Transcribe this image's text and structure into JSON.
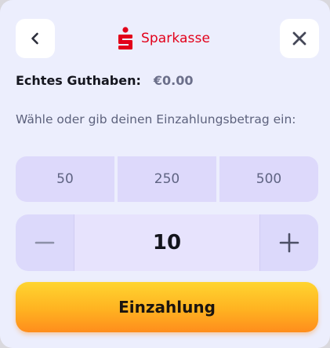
{
  "header": {
    "back_icon": "chevron-left-icon",
    "close_icon": "close-icon",
    "brand": {
      "logo_icon": "sparkasse-logo-icon",
      "name": "Sparkasse",
      "color": "#e2001a"
    }
  },
  "balance": {
    "label": "Echtes Guthaben:",
    "value": "€0.00"
  },
  "prompt": "Wähle oder gib deinen Einzahlungsbetrag ein:",
  "presets": [
    "50",
    "250",
    "500"
  ],
  "stepper": {
    "minus_icon": "minus-icon",
    "plus_icon": "plus-icon",
    "value": "10"
  },
  "deposit_button": {
    "label": "Einzahlung"
  },
  "colors": {
    "modal_bg": "#eceefd",
    "preset_bg": "#ddd9fb",
    "accent_gradient_start": "#ffd530",
    "accent_gradient_end": "#ff8d1c"
  }
}
